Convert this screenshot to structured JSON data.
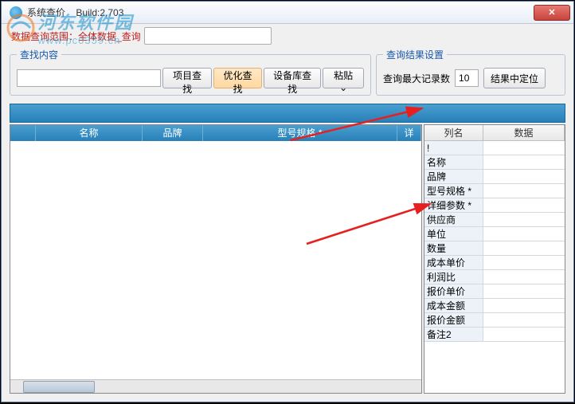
{
  "window": {
    "title": "系统查价",
    "build": "Build:2,703"
  },
  "scope": {
    "label": "数据查询范围：",
    "value": "全体数据_查询"
  },
  "search_panel": {
    "legend": "查找内容",
    "buttons": {
      "project": "项目查找",
      "optimize": "优化查找",
      "stock": "设备库查找",
      "paste": "粘贴 ⌄"
    }
  },
  "result_panel": {
    "legend": "查询结果设置",
    "max_label": "查询最大记录数",
    "max_value": "10",
    "locate_btn": "结果中定位"
  },
  "main_grid": {
    "columns": {
      "name": "名称",
      "brand": "品牌",
      "model": "型号规格  *",
      "detail": "详"
    }
  },
  "side_grid": {
    "header": {
      "col": "列名",
      "data": "数据"
    },
    "rows": [
      "!",
      "名称",
      "品牌",
      "型号规格 *",
      "详细参数 *",
      "供应商",
      "单位",
      "数量",
      "成本单价",
      "利润比",
      "报价单价",
      "成本金额",
      "报价金额",
      "备注2"
    ]
  },
  "watermark": {
    "cn": "河东软件园",
    "url": "www.pc0359.cn"
  }
}
